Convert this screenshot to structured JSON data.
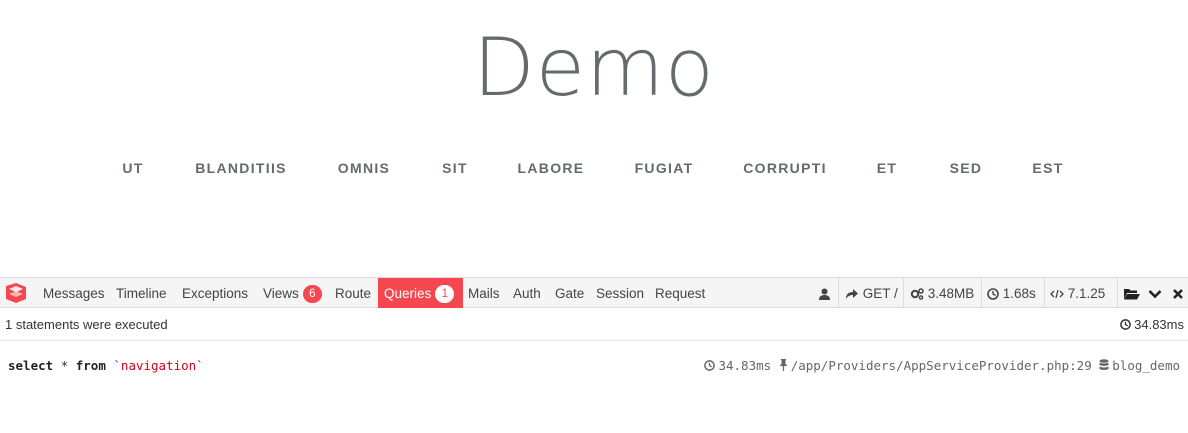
{
  "page": {
    "title": "Demo",
    "nav_links": [
      "UT",
      "BLANDITIIS",
      "OMNIS",
      "SIT",
      "LABORE",
      "FUGIAT",
      "CORRUPTI",
      "ET",
      "SED",
      "EST"
    ]
  },
  "debugbar": {
    "tabs": [
      {
        "label": "Messages"
      },
      {
        "label": "Timeline"
      },
      {
        "label": "Exceptions"
      },
      {
        "label": "Views",
        "badge": "6"
      },
      {
        "label": "Route"
      },
      {
        "label": "Queries",
        "badge": "1",
        "active": true
      },
      {
        "label": "Mails"
      },
      {
        "label": "Auth"
      },
      {
        "label": "Gate"
      },
      {
        "label": "Session"
      },
      {
        "label": "Request"
      }
    ],
    "right": {
      "request": "GET /",
      "memory": "3.48MB",
      "time": "1.68s",
      "php_version": "7.1.25"
    },
    "icons": {
      "logo": "laravel-logo-icon",
      "user": "user-icon",
      "share": "share-icon",
      "memory": "cogs-icon",
      "clock": "clock-icon",
      "code": "code-icon",
      "folder": "folder-open-icon",
      "minimize": "chevron-down-icon",
      "close": "close-icon"
    },
    "status": {
      "text": "1 statements were executed",
      "duration": "34.83ms"
    },
    "queries": [
      {
        "sql_keyword_1": "select",
        "sql_star": "*",
        "sql_keyword_2": "from",
        "sql_table": "`navigation`",
        "duration": "34.83ms",
        "source": "/app/Providers/AppServiceProvider.php:29",
        "connection": "blog_demo"
      }
    ],
    "colors": {
      "accent": "#f4474f",
      "header_bg": "#f5f5f5",
      "sql_string": "#d0021b"
    }
  }
}
